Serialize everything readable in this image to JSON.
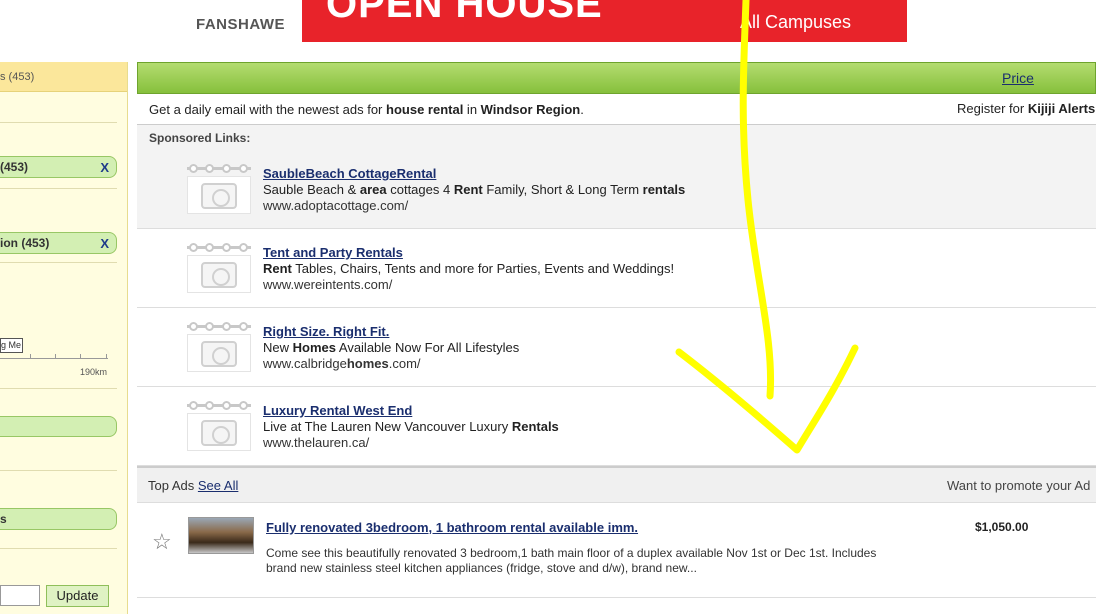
{
  "banner": {
    "brand": "FANSHAWE",
    "headline": "OPEN HOUSE",
    "sub": "All Campuses"
  },
  "sidebar": {
    "top_count": "s (453)",
    "filter1": "(453)",
    "filter2": "ion (453)",
    "remove": "X",
    "near_me": "g Me",
    "km": "190km",
    "pill3": "s",
    "update": "Update"
  },
  "sortbar": {
    "price": "Price"
  },
  "alert": {
    "pre": "Get a daily email with the newest ads for ",
    "term": "house rental",
    "mid": " in ",
    "region": "Windsor Region",
    "post": ".",
    "register_pre": "Register for ",
    "register_bold": "Kijiji Alerts"
  },
  "sponsored": {
    "heading": "Sponsored Links:",
    "items": [
      {
        "title": "SaubleBeach CottageRental",
        "desc": "Sauble Beach & area cottages 4 Rent Family, Short & Long Term rentals",
        "url": "www.adoptacottage.com/"
      },
      {
        "title": "Tent and Party Rentals",
        "desc": "Rent Tables, Chairs, Tents and more for Parties, Events and Weddings!",
        "url": "www.wereintents.com/"
      },
      {
        "title": "Right Size. Right Fit.",
        "desc": "New Homes Available Now For All Lifestyles",
        "url": "www.calbridgehomes.com/"
      },
      {
        "title": "Luxury Rental West End",
        "desc": "Live at The Lauren New Vancouver Luxury Rentals",
        "url": "www.thelauren.ca/"
      }
    ]
  },
  "topads": {
    "label": "Top Ads",
    "see_all": "See All",
    "promote": "Want to promote your Ad"
  },
  "ads": [
    {
      "title": "Fully renovated 3bedroom, 1 bathroom rental available imm.",
      "price": "$1,050.00",
      "desc": "Come see this beautifully renovated 3 bedroom,1 bath main floor of a duplex available Nov 1st or Dec 1st. Includes brand new stainless steel kitchen appliances (fridge, stove and d/w), brand new..."
    }
  ],
  "colors": {
    "green": "#8cc63e",
    "link": "#1a2e6e",
    "sidebar_bg": "#fffde0",
    "banner_red": "#e8232a",
    "annotation": "#ffff00"
  }
}
